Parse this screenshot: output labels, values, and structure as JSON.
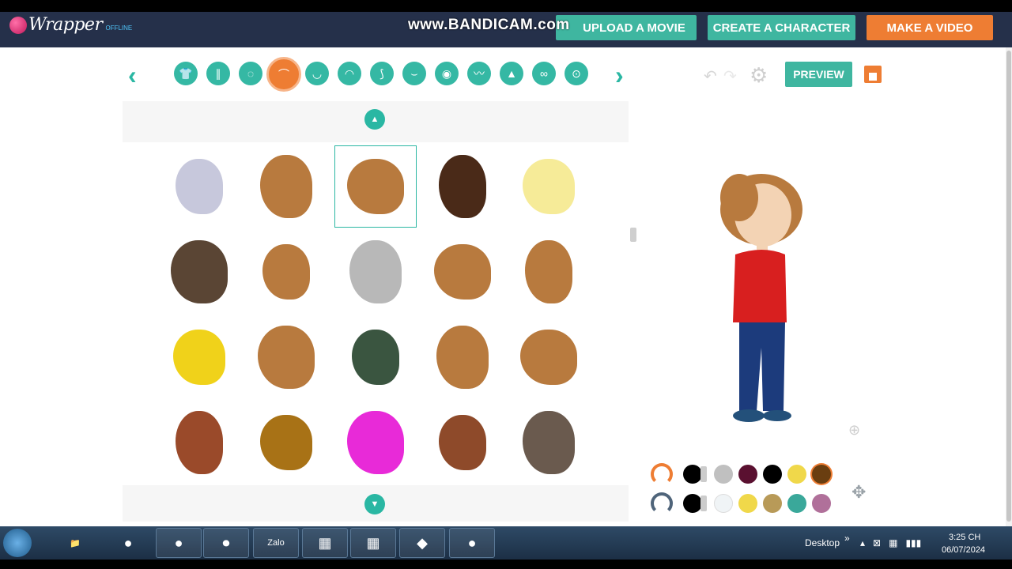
{
  "header": {
    "logo_text": "Wrapper",
    "logo_sub": "OFFLINE",
    "watermark": "www.BANDICAM.com",
    "buttons": {
      "upload": "UPLOAD A MOVIE",
      "create": "CREATE A CHARACTER",
      "video": "MAKE A VIDEO"
    }
  },
  "toolbar": {
    "prev_arrow": "‹",
    "next_arrow": "›",
    "categories": [
      {
        "name": "upper-body",
        "glyph": "👕"
      },
      {
        "name": "lower-body",
        "glyph": "∥"
      },
      {
        "name": "face-shape",
        "glyph": "◌"
      },
      {
        "name": "hair",
        "glyph": "⌒"
      },
      {
        "name": "facial-hair",
        "glyph": "◡"
      },
      {
        "name": "mouth",
        "glyph": "◠"
      },
      {
        "name": "ear",
        "glyph": "⟆"
      },
      {
        "name": "nose",
        "glyph": "⌣"
      },
      {
        "name": "eyes",
        "glyph": "◉"
      },
      {
        "name": "eyebrows",
        "glyph": "〰"
      },
      {
        "name": "hat",
        "glyph": "▲"
      },
      {
        "name": "glasses",
        "glyph": "∞"
      },
      {
        "name": "accessory",
        "glyph": "⊙"
      }
    ],
    "active_category": "hair",
    "undo": "↶",
    "redo": "↷",
    "settings": "⚙",
    "preview": "PREVIEW"
  },
  "grid": {
    "scroll_up": "▲",
    "scroll_down": "▼",
    "selected_index": 2,
    "rows": [
      [
        "#c7c8dc",
        "#b87a3e",
        "#b87a3e",
        "#4a2a18",
        "#f6eb98"
      ],
      [
        "#5a4534",
        "#b87a3e",
        "#b8b8b8",
        "#b87a3e",
        "#b87a3e"
      ],
      [
        "#f0d21a",
        "#b87a3e",
        "#3a5540",
        "#b87a3e",
        "#b87a3e"
      ],
      [
        "#9a4a2a",
        "#a87216",
        "#e82ad8",
        "#8e4a2a",
        "#6a5a4e"
      ]
    ]
  },
  "palette": {
    "row1": [
      "#000000",
      "#c0c0c0",
      "#5a1030",
      "#000000",
      "#f0d84a",
      "#6a3e10"
    ],
    "row2": [
      "#000000",
      "#f0f4f6",
      "#f0d84a",
      "#b89a58",
      "#3aa89a",
      "#b0709a"
    ],
    "row1_selected": 5,
    "icons": {
      "zoom": "⊕",
      "move": "✥"
    }
  },
  "taskbar": {
    "apps": [
      "📁",
      "●",
      "●",
      "⏺",
      "Zalo",
      "▦",
      "▦",
      "◆",
      "●"
    ],
    "desktop_label": "Desktop",
    "chevron": "»",
    "tray": [
      "▴",
      "⊠",
      "▦",
      "▮▮▮"
    ],
    "time": "3:25 CH",
    "date": "06/07/2024"
  }
}
